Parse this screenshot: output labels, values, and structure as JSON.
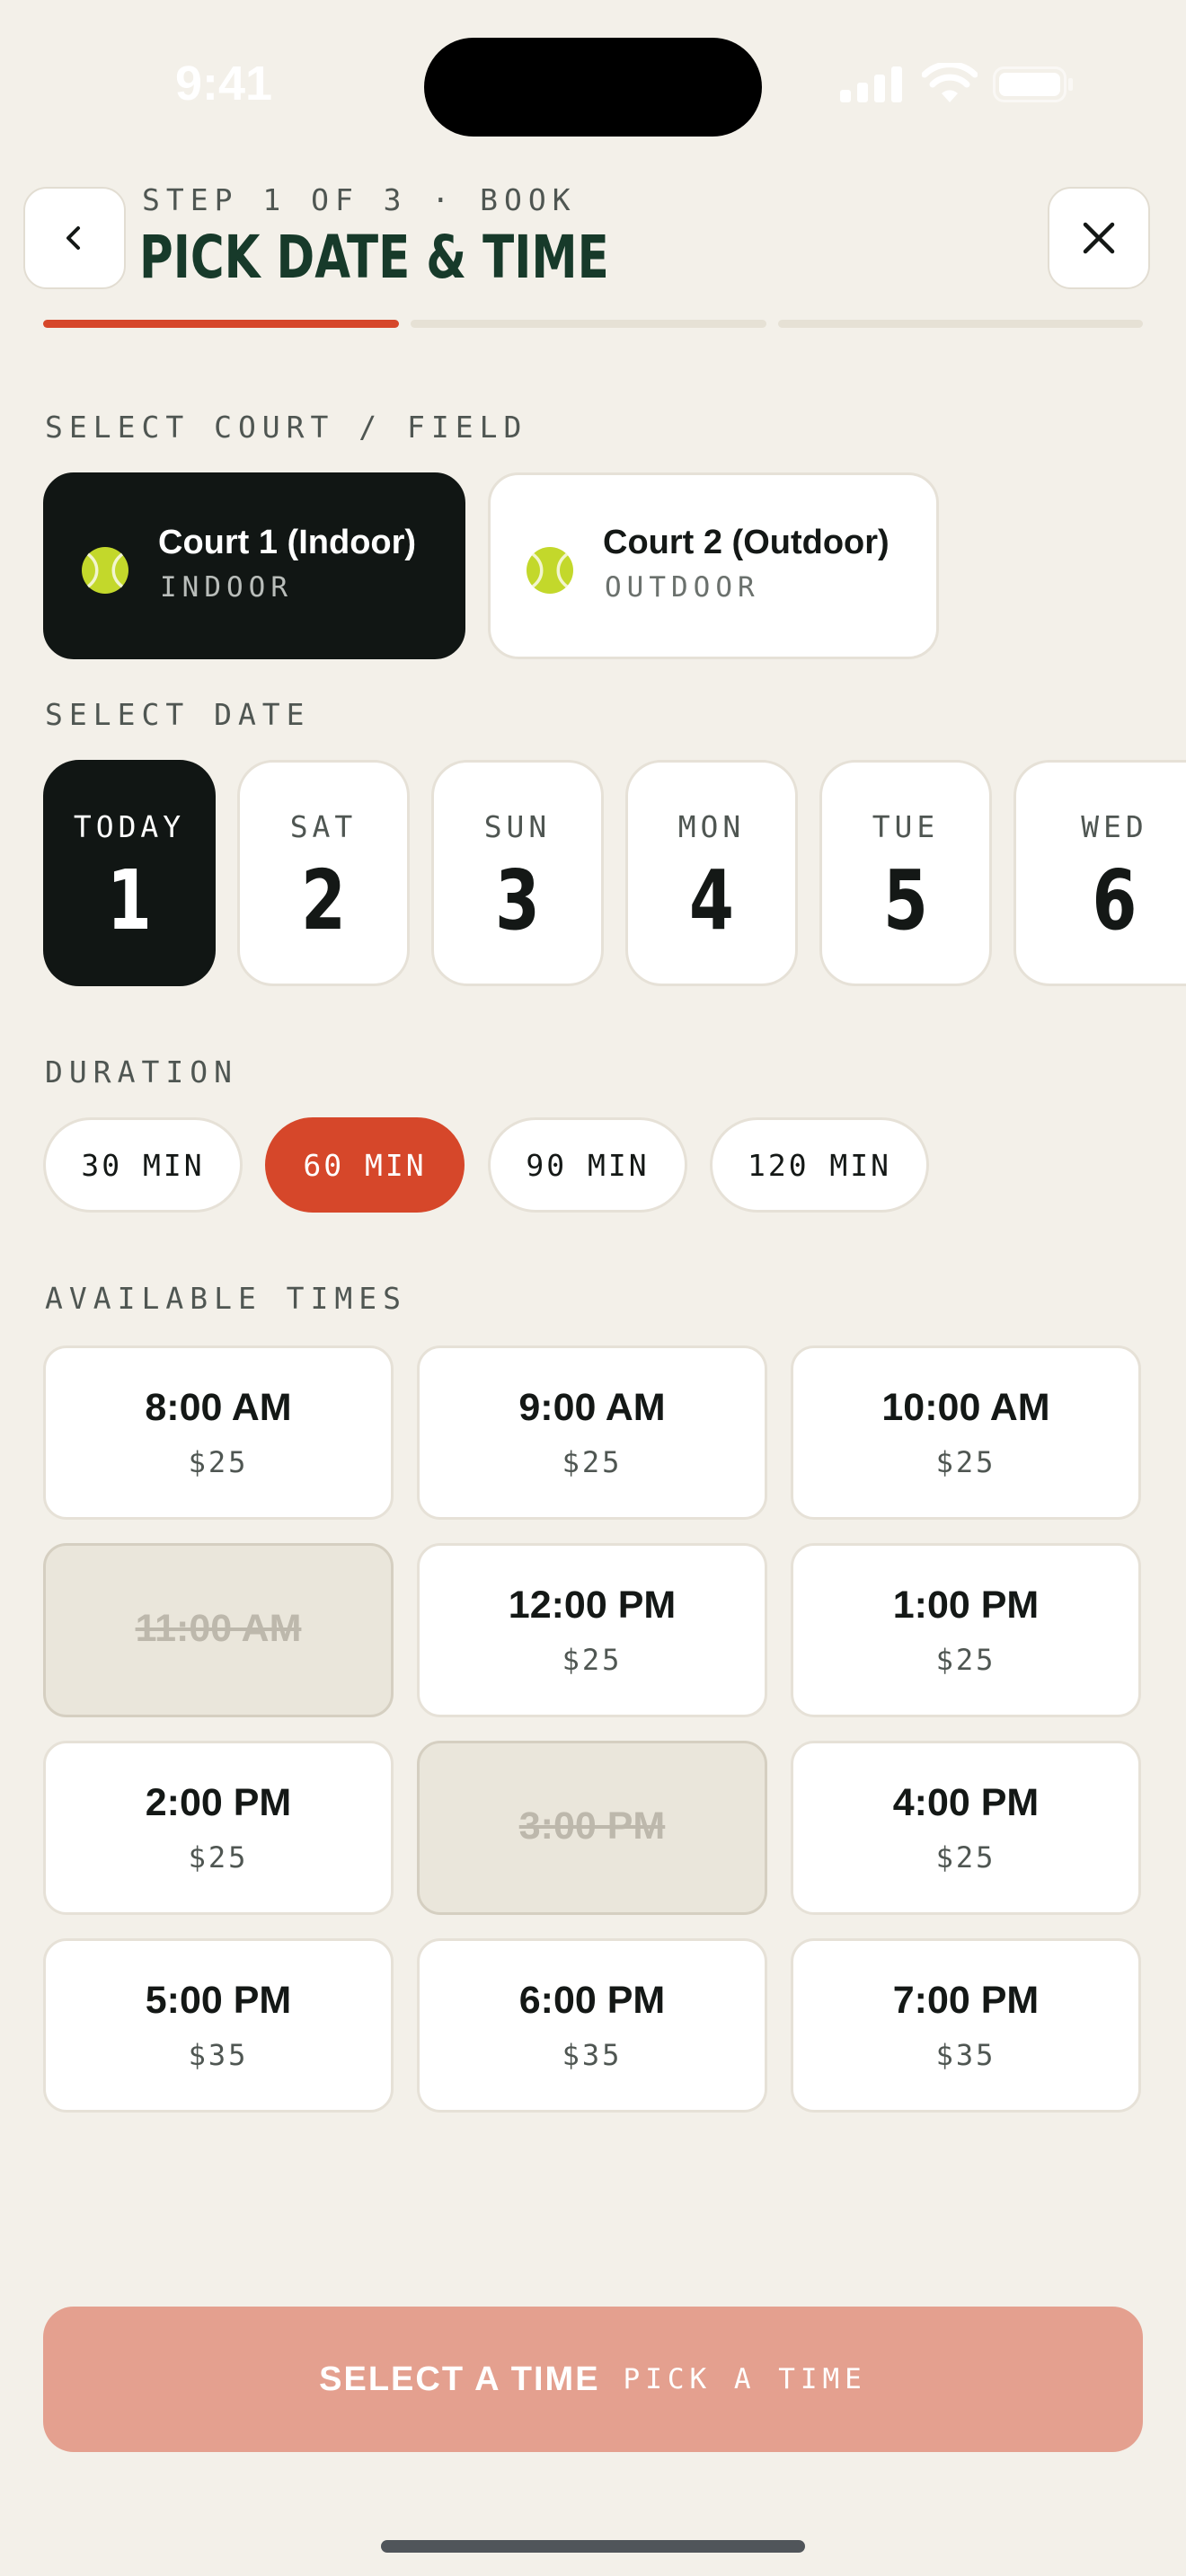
{
  "status_bar": {
    "time": "9:41"
  },
  "header": {
    "step_label": "STEP 1 OF 3 · BOOK",
    "title": "PICK DATE & TIME",
    "progress_steps": 3,
    "progress_current": 1,
    "colors": {
      "active": "#D6472A",
      "inactive": "#E6E1D5"
    }
  },
  "court_section": {
    "label": "SELECT COURT / FIELD",
    "courts": [
      {
        "name": "Court 1 (Indoor)",
        "type": "INDOOR",
        "selected": true,
        "icon": "tennis-ball-icon"
      },
      {
        "name": "Court 2 (Outdoor)",
        "type": "OUTDOOR",
        "selected": false,
        "icon": "tennis-ball-icon"
      }
    ]
  },
  "date_section": {
    "label": "SELECT DATE",
    "dates": [
      {
        "day": "TODAY",
        "num": "1",
        "selected": true
      },
      {
        "day": "SAT",
        "num": "2",
        "selected": false
      },
      {
        "day": "SUN",
        "num": "3",
        "selected": false
      },
      {
        "day": "MON",
        "num": "4",
        "selected": false
      },
      {
        "day": "TUE",
        "num": "5",
        "selected": false
      },
      {
        "day": "WED",
        "num": "6",
        "selected": false
      }
    ]
  },
  "duration_section": {
    "label": "DURATION",
    "options": [
      {
        "label": "30 MIN",
        "selected": false
      },
      {
        "label": "60 MIN",
        "selected": true
      },
      {
        "label": "90 MIN",
        "selected": false
      },
      {
        "label": "120 MIN",
        "selected": false
      }
    ]
  },
  "times_section": {
    "label": "AVAILABLE TIMES",
    "slots": [
      {
        "time": "8:00 AM",
        "price": "$25",
        "available": true
      },
      {
        "time": "9:00 AM",
        "price": "$25",
        "available": true
      },
      {
        "time": "10:00 AM",
        "price": "$25",
        "available": true
      },
      {
        "time": "11:00 AM",
        "price": "",
        "available": false
      },
      {
        "time": "12:00 PM",
        "price": "$25",
        "available": true
      },
      {
        "time": "1:00 PM",
        "price": "$25",
        "available": true
      },
      {
        "time": "2:00 PM",
        "price": "$25",
        "available": true
      },
      {
        "time": "3:00 PM",
        "price": "",
        "available": false
      },
      {
        "time": "4:00 PM",
        "price": "$25",
        "available": true
      },
      {
        "time": "5:00 PM",
        "price": "$35",
        "available": true
      },
      {
        "time": "6:00 PM",
        "price": "$35",
        "available": true
      },
      {
        "time": "7:00 PM",
        "price": "$35",
        "available": true
      }
    ]
  },
  "cta": {
    "label": "SELECT A TIME",
    "sublabel": "PICK A TIME",
    "color": "#E4A08F"
  },
  "icons": [
    "back-chevron-icon",
    "close-icon",
    "signal-icon",
    "wifi-icon",
    "battery-icon",
    "tennis-ball-icon"
  ]
}
